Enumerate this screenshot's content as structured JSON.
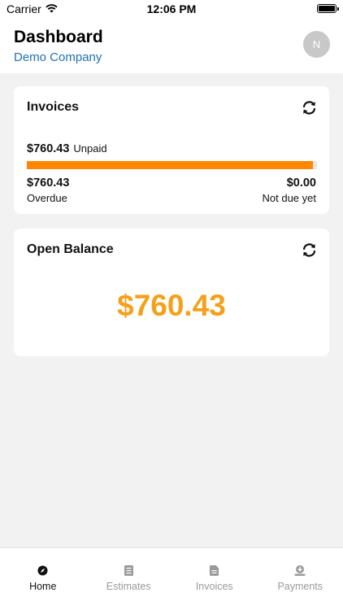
{
  "status_bar": {
    "carrier": "Carrier",
    "time": "12:06 PM"
  },
  "header": {
    "title": "Dashboard",
    "company": "Demo Company",
    "avatar_initial": "N"
  },
  "invoices_card": {
    "title": "Invoices",
    "unpaid_amount": "$760.43",
    "unpaid_label": "Unpaid",
    "progress_fraction": 0.987,
    "overdue_amount": "$760.43",
    "overdue_label": "Overdue",
    "not_due_amount": "$0.00",
    "not_due_label": "Not due yet"
  },
  "balance_card": {
    "title": "Open Balance",
    "amount": "$760.43"
  },
  "tabs": [
    {
      "label": "Home",
      "icon": "compass-icon",
      "active": true
    },
    {
      "label": "Estimates",
      "icon": "list-document-icon",
      "active": false
    },
    {
      "label": "Invoices",
      "icon": "invoice-document-icon",
      "active": false
    },
    {
      "label": "Payments",
      "icon": "payment-download-icon",
      "active": false
    }
  ],
  "colors": {
    "accent_link": "#1f6fb3",
    "progress": "#ff8800",
    "balance": "#f5a01a",
    "tab_inactive": "#9a9a9a"
  }
}
